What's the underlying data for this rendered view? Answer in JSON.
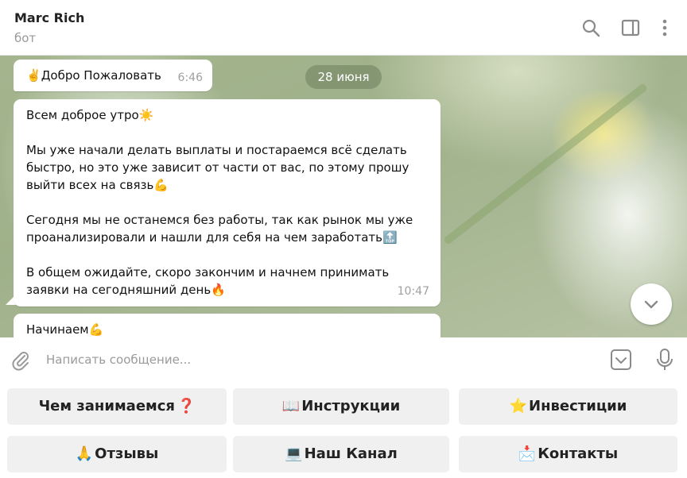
{
  "header": {
    "title": "Marc Rich",
    "subtitle": "бот",
    "icons": [
      "search-icon",
      "sidebar-toggle-icon",
      "more-vertical-icon"
    ]
  },
  "chat": {
    "date_label": "28 июня",
    "messages": [
      {
        "emoji": "✌️",
        "text": "Добро Пожаловать",
        "time": "6:46"
      },
      {
        "paragraphs": [
          "Всем доброе утро☀️",
          "Мы уже начали делать выплаты и постараемся всё сделать быстро, но это уже зависит от части от вас, по этому прошу выйти всех на связь💪",
          "Сегодня мы не останемся без работы, так как рынок мы уже проанализировали и нашли для себя на чем заработать🔝",
          "В общем ожидайте, скоро закончим и начнем принимать заявки на сегодняшний день🔥"
        ],
        "time": "10:47"
      },
      {
        "text": "Начинаем💪"
      }
    ]
  },
  "composer": {
    "placeholder": "Написать сообщение...",
    "icons": [
      "paperclip-icon",
      "bot-keyboard-icon",
      "microphone-icon"
    ]
  },
  "keyboard": {
    "buttons": [
      {
        "label": "Чем занимаемся",
        "emoji": "❓",
        "emoji_pos": "after"
      },
      {
        "label": "Инструкции",
        "emoji": "📖",
        "emoji_pos": "before"
      },
      {
        "label": "Инвестиции",
        "emoji": "⭐",
        "emoji_pos": "before"
      },
      {
        "label": "Отзывы",
        "emoji": "🙏",
        "emoji_pos": "before"
      },
      {
        "label": "Наш Канал",
        "emoji": "💻",
        "emoji_pos": "before"
      },
      {
        "label": "Контакты",
        "emoji": "📩",
        "emoji_pos": "before"
      }
    ]
  }
}
